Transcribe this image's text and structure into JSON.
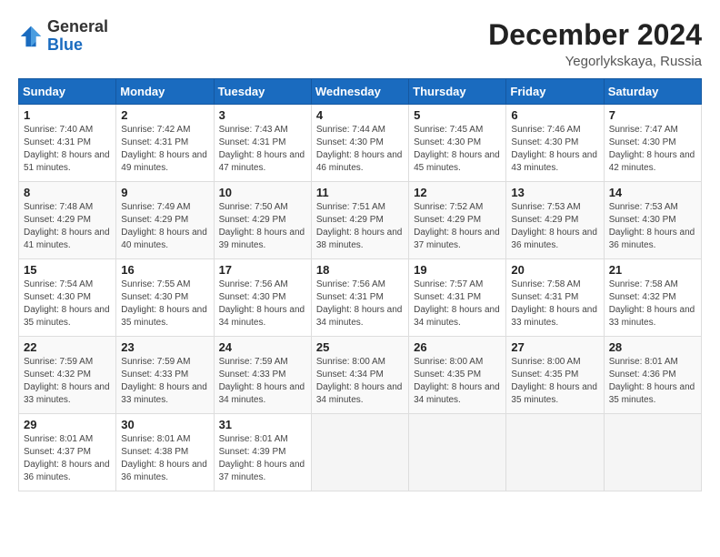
{
  "header": {
    "logo_general": "General",
    "logo_blue": "Blue",
    "month_title": "December 2024",
    "location": "Yegorlykskaya, Russia"
  },
  "weekdays": [
    "Sunday",
    "Monday",
    "Tuesday",
    "Wednesday",
    "Thursday",
    "Friday",
    "Saturday"
  ],
  "weeks": [
    [
      {
        "day": "1",
        "sunrise": "7:40 AM",
        "sunset": "4:31 PM",
        "daylight": "8 hours and 51 minutes."
      },
      {
        "day": "2",
        "sunrise": "7:42 AM",
        "sunset": "4:31 PM",
        "daylight": "8 hours and 49 minutes."
      },
      {
        "day": "3",
        "sunrise": "7:43 AM",
        "sunset": "4:31 PM",
        "daylight": "8 hours and 47 minutes."
      },
      {
        "day": "4",
        "sunrise": "7:44 AM",
        "sunset": "4:30 PM",
        "daylight": "8 hours and 46 minutes."
      },
      {
        "day": "5",
        "sunrise": "7:45 AM",
        "sunset": "4:30 PM",
        "daylight": "8 hours and 45 minutes."
      },
      {
        "day": "6",
        "sunrise": "7:46 AM",
        "sunset": "4:30 PM",
        "daylight": "8 hours and 43 minutes."
      },
      {
        "day": "7",
        "sunrise": "7:47 AM",
        "sunset": "4:30 PM",
        "daylight": "8 hours and 42 minutes."
      }
    ],
    [
      {
        "day": "8",
        "sunrise": "7:48 AM",
        "sunset": "4:29 PM",
        "daylight": "8 hours and 41 minutes."
      },
      {
        "day": "9",
        "sunrise": "7:49 AM",
        "sunset": "4:29 PM",
        "daylight": "8 hours and 40 minutes."
      },
      {
        "day": "10",
        "sunrise": "7:50 AM",
        "sunset": "4:29 PM",
        "daylight": "8 hours and 39 minutes."
      },
      {
        "day": "11",
        "sunrise": "7:51 AM",
        "sunset": "4:29 PM",
        "daylight": "8 hours and 38 minutes."
      },
      {
        "day": "12",
        "sunrise": "7:52 AM",
        "sunset": "4:29 PM",
        "daylight": "8 hours and 37 minutes."
      },
      {
        "day": "13",
        "sunrise": "7:53 AM",
        "sunset": "4:29 PM",
        "daylight": "8 hours and 36 minutes."
      },
      {
        "day": "14",
        "sunrise": "7:53 AM",
        "sunset": "4:30 PM",
        "daylight": "8 hours and 36 minutes."
      }
    ],
    [
      {
        "day": "15",
        "sunrise": "7:54 AM",
        "sunset": "4:30 PM",
        "daylight": "8 hours and 35 minutes."
      },
      {
        "day": "16",
        "sunrise": "7:55 AM",
        "sunset": "4:30 PM",
        "daylight": "8 hours and 35 minutes."
      },
      {
        "day": "17",
        "sunrise": "7:56 AM",
        "sunset": "4:30 PM",
        "daylight": "8 hours and 34 minutes."
      },
      {
        "day": "18",
        "sunrise": "7:56 AM",
        "sunset": "4:31 PM",
        "daylight": "8 hours and 34 minutes."
      },
      {
        "day": "19",
        "sunrise": "7:57 AM",
        "sunset": "4:31 PM",
        "daylight": "8 hours and 34 minutes."
      },
      {
        "day": "20",
        "sunrise": "7:58 AM",
        "sunset": "4:31 PM",
        "daylight": "8 hours and 33 minutes."
      },
      {
        "day": "21",
        "sunrise": "7:58 AM",
        "sunset": "4:32 PM",
        "daylight": "8 hours and 33 minutes."
      }
    ],
    [
      {
        "day": "22",
        "sunrise": "7:59 AM",
        "sunset": "4:32 PM",
        "daylight": "8 hours and 33 minutes."
      },
      {
        "day": "23",
        "sunrise": "7:59 AM",
        "sunset": "4:33 PM",
        "daylight": "8 hours and 33 minutes."
      },
      {
        "day": "24",
        "sunrise": "7:59 AM",
        "sunset": "4:33 PM",
        "daylight": "8 hours and 34 minutes."
      },
      {
        "day": "25",
        "sunrise": "8:00 AM",
        "sunset": "4:34 PM",
        "daylight": "8 hours and 34 minutes."
      },
      {
        "day": "26",
        "sunrise": "8:00 AM",
        "sunset": "4:35 PM",
        "daylight": "8 hours and 34 minutes."
      },
      {
        "day": "27",
        "sunrise": "8:00 AM",
        "sunset": "4:35 PM",
        "daylight": "8 hours and 35 minutes."
      },
      {
        "day": "28",
        "sunrise": "8:01 AM",
        "sunset": "4:36 PM",
        "daylight": "8 hours and 35 minutes."
      }
    ],
    [
      {
        "day": "29",
        "sunrise": "8:01 AM",
        "sunset": "4:37 PM",
        "daylight": "8 hours and 36 minutes."
      },
      {
        "day": "30",
        "sunrise": "8:01 AM",
        "sunset": "4:38 PM",
        "daylight": "8 hours and 36 minutes."
      },
      {
        "day": "31",
        "sunrise": "8:01 AM",
        "sunset": "4:39 PM",
        "daylight": "8 hours and 37 minutes."
      },
      null,
      null,
      null,
      null
    ]
  ]
}
